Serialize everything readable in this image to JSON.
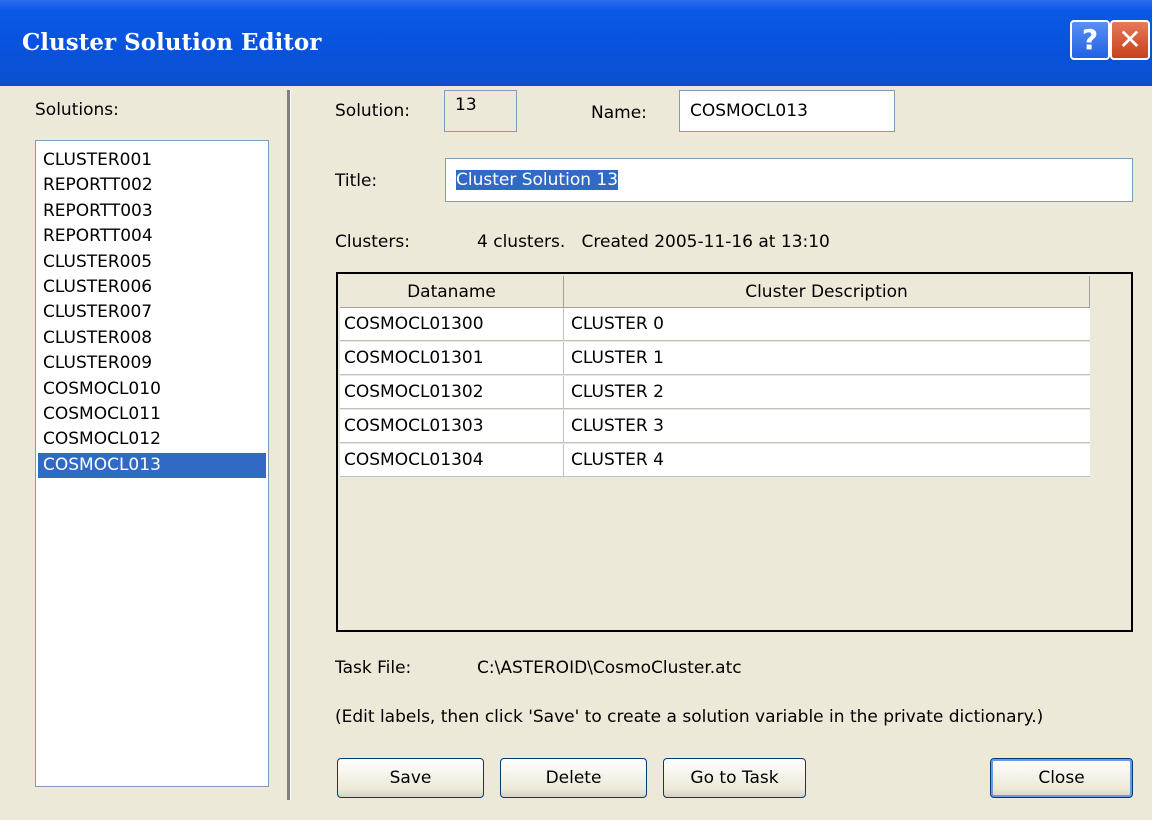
{
  "window": {
    "title": "Cluster Solution Editor"
  },
  "titlebar": {
    "help_glyph": "?",
    "close_glyph": "✕"
  },
  "sidebar": {
    "label": "Solutions:",
    "items": [
      "CLUSTER001",
      "REPORTT002",
      "REPORTT003",
      "REPORTT004",
      "CLUSTER005",
      "CLUSTER006",
      "CLUSTER007",
      "CLUSTER008",
      "CLUSTER009",
      "COSMOCL010",
      "COSMOCL011",
      "COSMOCL012",
      "COSMOCL013"
    ],
    "selected": "COSMOCL013"
  },
  "form": {
    "solution_label": "Solution:",
    "solution_value": "13",
    "name_label": "Name:",
    "name_value": "COSMOCL013",
    "title_label": "Title:",
    "title_value": "Cluster Solution 13",
    "clusters_label": "Clusters:",
    "clusters_value": "4 clusters.   Created 2005-11-16 at 13:10"
  },
  "table": {
    "headers": [
      "Dataname",
      "Cluster Description"
    ],
    "rows": [
      [
        "COSMOCL01300",
        "CLUSTER 0"
      ],
      [
        "COSMOCL01301",
        "CLUSTER 1"
      ],
      [
        "COSMOCL01302",
        "CLUSTER 2"
      ],
      [
        "COSMOCL01303",
        "CLUSTER 3"
      ],
      [
        "COSMOCL01304",
        "CLUSTER 4"
      ]
    ]
  },
  "task": {
    "label": "Task File:",
    "value": "C:\\ASTEROID\\CosmoCluster.atc"
  },
  "hint": "(Edit labels, then click 'Save' to create a solution variable in the private dictionary.)",
  "buttons": {
    "save": "Save",
    "delete": "Delete",
    "goto_task": "Go to Task",
    "close": "Close"
  },
  "colors": {
    "titlebar": "#0a58e6",
    "selection": "#316ac5",
    "dialog_bg": "#ece9d8"
  }
}
